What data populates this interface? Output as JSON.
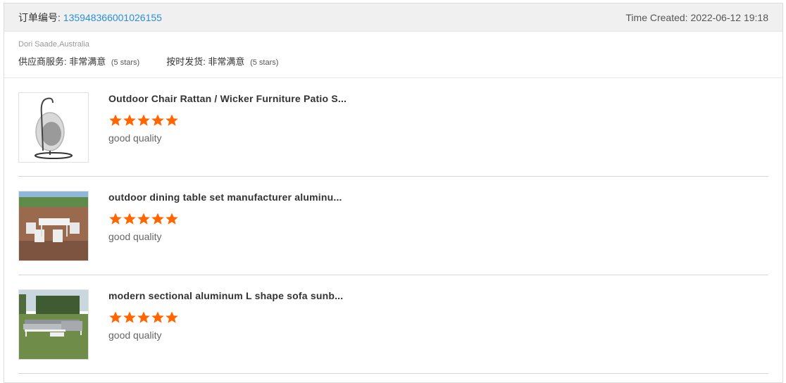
{
  "header": {
    "order_label": "订单编号: ",
    "order_number": "135948366001026155",
    "time_created": "Time Created: 2022-06-12 19:18"
  },
  "meta": {
    "customer": "Dori Saade,Australia",
    "supplier_service_label": "供应商服务: 非常满意",
    "supplier_service_note": "(5 stars)",
    "shipping_label": "按时发货: 非常满意",
    "shipping_note": "(5 stars)"
  },
  "colors": {
    "accent_link": "#2a8fd6",
    "star": "#ff6600"
  },
  "items": [
    {
      "title": "Outdoor Chair Rattan / Wicker Furniture Patio S...",
      "rating": 5,
      "review": "good quality",
      "thumb_icon": "hanging-egg-chair-image"
    },
    {
      "title": "outdoor dining table set manufacturer aluminu...",
      "rating": 5,
      "review": "good quality",
      "thumb_icon": "dining-set-image"
    },
    {
      "title": "modern sectional aluminum L shape sofa sunb...",
      "rating": 5,
      "review": "good quality",
      "thumb_icon": "sectional-sofa-image"
    }
  ]
}
